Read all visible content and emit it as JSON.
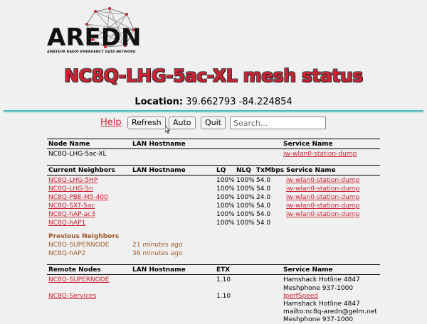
{
  "logo": {
    "text": "AREDN",
    "subtitle": "AMATEUR RADIO EMERGENCY DATA NETWORK"
  },
  "title": "NC8Q-LHG-5ac-XL mesh status",
  "location": {
    "label": "Location:",
    "value": "39.662793 -84.224854"
  },
  "toolbar": {
    "help": "Help",
    "refresh": "Refresh",
    "auto": "Auto",
    "quit": "Quit",
    "search_placeholder": "Search..."
  },
  "node_table": {
    "headers": {
      "name": "Node Name",
      "lan": "LAN Hostname",
      "service": "Service Name"
    },
    "row": {
      "name": "NC8Q-LHG-5ac-XL",
      "service": "iw-wlan0-station-dump"
    }
  },
  "neighbors_table": {
    "headers": {
      "name": "Current Neighbors",
      "lan": "LAN Hostname",
      "lq": "LQ",
      "nlq": "NLQ",
      "tx": "TxMbps",
      "service": "Service Name"
    },
    "rows": [
      {
        "name": "NC8Q-LHG-5HP",
        "lq": "100%",
        "nlq": "100%",
        "tx": "54.0",
        "service": "iw-wlan0-station-dump"
      },
      {
        "name": "NC8Q-LHG-5n",
        "lq": "100%",
        "nlq": "100%",
        "tx": "54.0",
        "service": "iw-wlan0-station-dump"
      },
      {
        "name": "NC8Q-PBE-M5-400",
        "lq": "100%",
        "nlq": "100%",
        "tx": "24.0",
        "service": "iw-wlan0-station-dump"
      },
      {
        "name": "NC8Q-SXT-5ac",
        "lq": "100%",
        "nlq": "100%",
        "tx": "54.0",
        "service": "iw-wlan0-station-dump"
      },
      {
        "name": "NC8Q-hAP-ac3",
        "lq": "100%",
        "nlq": "100%",
        "tx": "54.0",
        "service": "iw-wlan0-station-dump"
      },
      {
        "name": "NC8Q-hAP1",
        "lq": "100%",
        "nlq": "100%",
        "tx": "54.0",
        "service": ""
      }
    ],
    "previous_label": "Previous Neighbors",
    "previous": [
      {
        "name": "NC8Q-SUPERNODE",
        "ago": "21 minutes ago"
      },
      {
        "name": "NC8Q-hAP2",
        "ago": "36 minutes ago"
      }
    ]
  },
  "remote_table": {
    "headers": {
      "name": "Remote Nodes",
      "lan": "LAN Hostname",
      "etx": "ETX",
      "service": "Service Name"
    },
    "rows": [
      {
        "name": "NC8Q-SUPERNODE",
        "etx": "1.10",
        "services": [
          "Hamshack Hotline 4847",
          "Meshphone 937-1000"
        ]
      },
      {
        "name": "NC8Q-Services",
        "etx": "1.10",
        "services": [
          "IperfSpeed",
          "Hamshack Hotline 4847",
          "mailto:nc8q-aredn@gelm.net",
          "Meshphone 937-1000"
        ]
      }
    ]
  },
  "colors": {
    "accent": "#cc2233",
    "divider": "#53b8c0",
    "previous": "#a05a2c",
    "background": "#f0f0f0"
  }
}
